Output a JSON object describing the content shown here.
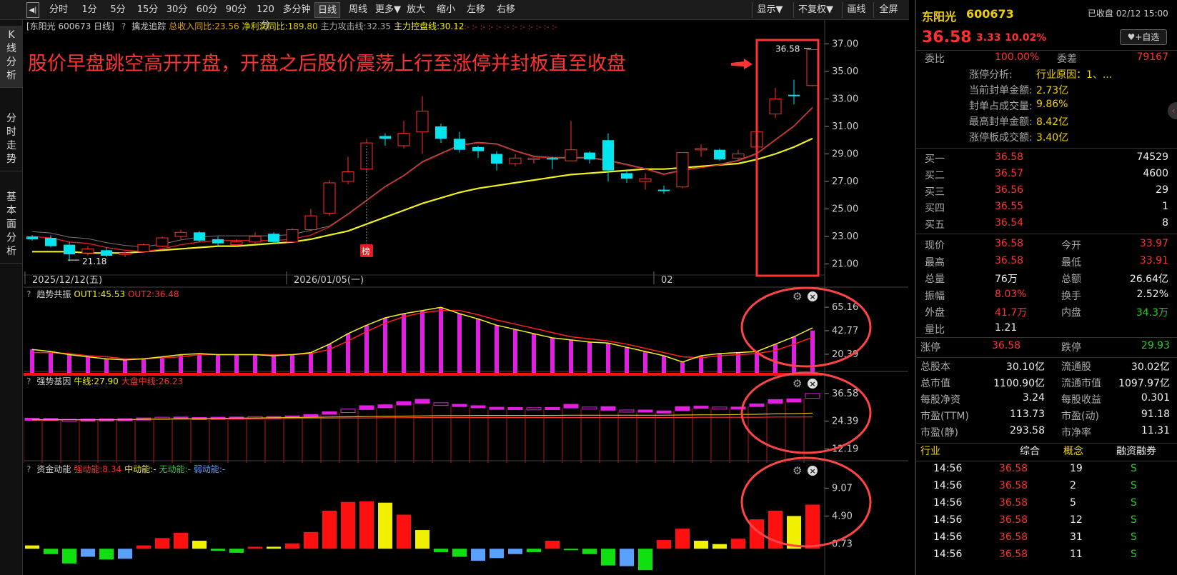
{
  "colors": {
    "up": "#ff3030",
    "down": "#00e5ee",
    "ma5": "#e02020",
    "ma10": "#f0f020",
    "bg": "#000000",
    "annotation": "#ff3333",
    "circle": "#ff4444"
  },
  "toolbar": {
    "icon": "back-arrow-icon",
    "items": [
      "分时",
      "1分",
      "5分",
      "15分",
      "30分",
      "60分",
      "90分",
      "120分",
      "多分钟",
      "日线",
      "周线",
      "更多▼",
      "放大",
      "缩小",
      "左移",
      "右移"
    ],
    "active": "日线",
    "right_items": [
      "显示▼",
      "不复权▼",
      "画线",
      "全屏"
    ]
  },
  "sidenav": {
    "items": [
      "K线分析",
      "分时走势",
      "基本面分析"
    ]
  },
  "main_chart": {
    "header": {
      "stock": "[东阳光 600673 日线]",
      "help": "?",
      "indicator": "擒龙追踪",
      "rev": "总收入同比:23.56",
      "profit": "净利润同比:189.80",
      "attack": "主力攻击线:32.35",
      "control": "主力控盘线:30.12"
    },
    "annotation": "股价早盘跳空高开开盘，开盘之后股价震荡上行至涨停并封板直至收盘",
    "price_label_high": "36.58",
    "price_label_low": "21.18",
    "badge": "榜",
    "yticks": [
      "37.00",
      "35.00",
      "33.00",
      "31.00",
      "29.00",
      "27.00",
      "25.00",
      "23.00",
      "21.00"
    ],
    "dates": [
      "2025/12/12(五)",
      "2026/01/05(一)",
      "02"
    ]
  },
  "chart_data": [
    {
      "type": "candlestick",
      "title": "东阳光 600673 日线",
      "ylim": [
        20.2,
        37.8
      ],
      "candles": [
        [
          23.0,
          22.8,
          23.1,
          22.7
        ],
        [
          22.9,
          22.3,
          23.1,
          22.2
        ],
        [
          22.4,
          21.7,
          22.6,
          21.2
        ],
        [
          21.8,
          22.1,
          22.3,
          21.6
        ],
        [
          22.0,
          21.6,
          22.2,
          21.5
        ],
        [
          21.7,
          21.8,
          21.9,
          21.5
        ],
        [
          21.9,
          22.4,
          22.5,
          21.8
        ],
        [
          22.3,
          22.9,
          23.0,
          22.2
        ],
        [
          23.0,
          23.3,
          23.5,
          22.8
        ],
        [
          23.3,
          22.7,
          23.4,
          22.6
        ],
        [
          22.8,
          22.5,
          23.0,
          22.3
        ],
        [
          22.4,
          22.6,
          22.8,
          22.3
        ],
        [
          22.6,
          23.0,
          23.3,
          22.5
        ],
        [
          23.2,
          22.6,
          23.3,
          22.5
        ],
        [
          22.6,
          23.5,
          23.6,
          22.6
        ],
        [
          23.5,
          24.5,
          25.0,
          23.4
        ],
        [
          24.7,
          26.9,
          27.1,
          24.5
        ],
        [
          27.0,
          27.7,
          28.8,
          26.8
        ],
        [
          27.9,
          29.8,
          30.1,
          27.7
        ],
        [
          30.3,
          30.1,
          30.5,
          29.6
        ],
        [
          29.6,
          30.5,
          31.4,
          29.4
        ],
        [
          30.6,
          32.1,
          33.2,
          29.0
        ],
        [
          31.0,
          30.1,
          31.2,
          29.8
        ],
        [
          30.1,
          29.3,
          30.6,
          29.1
        ],
        [
          29.5,
          29.2,
          29.6,
          28.7
        ],
        [
          29.0,
          28.3,
          29.2,
          27.8
        ],
        [
          28.3,
          28.7,
          29.0,
          28.1
        ],
        [
          28.6,
          28.7,
          28.8,
          28.3
        ],
        [
          28.7,
          28.6,
          28.8,
          27.9
        ],
        [
          28.5,
          29.3,
          31.4,
          28.5
        ],
        [
          29.1,
          28.6,
          29.2,
          28.3
        ],
        [
          30.0,
          27.8,
          30.5,
          27.0
        ],
        [
          27.6,
          27.2,
          27.8,
          26.9
        ],
        [
          27.0,
          27.2,
          27.6,
          26.4
        ],
        [
          26.4,
          26.3,
          26.7,
          26.1
        ],
        [
          26.6,
          29.1,
          29.1,
          26.5
        ],
        [
          29.3,
          29.4,
          29.7,
          28.8
        ],
        [
          29.3,
          28.6,
          29.4,
          28.5
        ],
        [
          28.7,
          29.0,
          29.3,
          28.5
        ],
        [
          29.5,
          30.6,
          31.3,
          29.5
        ],
        [
          31.9,
          33.0,
          33.8,
          31.6
        ],
        [
          33.3,
          33.2,
          34.4,
          32.6
        ],
        [
          33.97,
          36.58,
          36.58,
          33.91
        ]
      ],
      "ma5": [
        23.0,
        22.9,
        22.6,
        22.5,
        22.2,
        22.0,
        21.9,
        22.1,
        22.4,
        22.6,
        22.7,
        22.7,
        22.7,
        22.7,
        22.8,
        23.1,
        23.7,
        24.6,
        25.6,
        26.6,
        27.4,
        28.4,
        29.0,
        29.6,
        29.8,
        29.7,
        29.2,
        28.8,
        28.7,
        28.7,
        28.7,
        28.5,
        28.2,
        27.9,
        27.5,
        27.8,
        28.0,
        28.2,
        28.5,
        29.0,
        30.0,
        31.0,
        32.35
      ],
      "ma10": [
        21.9,
        21.9,
        21.9,
        21.8,
        21.8,
        21.8,
        21.9,
        22.0,
        22.1,
        22.2,
        22.3,
        22.3,
        22.4,
        22.5,
        22.6,
        22.8,
        23.1,
        23.4,
        23.9,
        24.4,
        24.9,
        25.4,
        25.8,
        26.2,
        26.5,
        26.7,
        26.9,
        27.1,
        27.3,
        27.5,
        27.6,
        27.7,
        27.8,
        27.9,
        27.9,
        28.0,
        28.1,
        28.2,
        28.3,
        28.6,
        29.0,
        29.5,
        30.12
      ]
    },
    {
      "type": "bar+line",
      "title": "趋势共振",
      "series_labels": [
        "OUT1:45.53",
        "OUT2:36.48"
      ],
      "yticks": [
        "65.16",
        "42.77",
        "20.39"
      ],
      "ylim": [
        2,
        72
      ],
      "values": [
        25,
        23,
        20,
        18,
        16,
        15,
        16,
        18,
        20,
        21,
        20,
        20,
        20,
        19,
        20,
        22,
        30,
        40,
        48,
        55,
        59,
        62,
        65,
        59,
        54,
        48,
        44,
        40,
        36,
        34,
        32,
        31,
        27,
        23,
        19,
        13,
        19,
        21,
        22,
        23,
        30,
        37,
        43
      ],
      "out1": [
        25,
        23,
        20,
        18,
        16,
        15,
        16,
        18,
        20,
        21,
        20,
        20,
        20,
        19,
        20,
        22,
        30,
        40,
        48,
        55,
        59,
        62,
        65,
        59,
        54,
        48,
        44,
        40,
        36,
        34,
        32,
        31,
        27,
        23,
        19,
        13,
        19,
        21,
        22,
        23,
        30,
        37,
        45.53
      ],
      "out2": [
        22,
        22,
        21,
        19,
        18,
        16,
        16,
        17,
        18,
        20,
        20,
        20,
        20,
        20,
        20,
        21,
        25,
        33,
        42,
        50,
        56,
        60,
        62,
        62,
        58,
        53,
        49,
        45,
        41,
        37,
        35,
        33,
        30,
        26,
        22,
        18,
        17,
        19,
        20,
        21,
        24,
        30,
        36.48
      ]
    },
    {
      "type": "box+line",
      "title": "强势基因",
      "series_labels": [
        "牛线:27.90",
        "大盘中线:26.23"
      ],
      "yticks": [
        "36.58",
        "24.39",
        "12.19"
      ],
      "ylim": [
        6,
        40
      ],
      "boxes": [
        [
          25.4,
          25.7
        ],
        [
          25.3,
          25.6
        ],
        [
          24.8,
          25.2
        ],
        [
          24.9,
          25.3
        ],
        [
          25.0,
          25.4
        ],
        [
          25.2,
          25.5
        ],
        [
          25.4,
          25.8
        ],
        [
          25.7,
          26.1
        ],
        [
          25.8,
          26.2
        ],
        [
          25.6,
          26.0
        ],
        [
          25.7,
          26.1
        ],
        [
          25.8,
          26.2
        ],
        [
          26.0,
          26.4
        ],
        [
          26.0,
          26.4
        ],
        [
          26.2,
          26.7
        ],
        [
          26.7,
          27.3
        ],
        [
          27.4,
          28.5
        ],
        [
          28.2,
          29.7
        ],
        [
          29.5,
          31.2
        ],
        [
          30.3,
          31.6
        ],
        [
          31.5,
          33.0
        ],
        [
          32.3,
          34.0
        ],
        [
          31.3,
          32.5
        ],
        [
          30.8,
          31.8
        ],
        [
          30.3,
          31.2
        ],
        [
          29.6,
          30.5
        ],
        [
          29.6,
          30.4
        ],
        [
          29.6,
          30.3
        ],
        [
          29.6,
          30.4
        ],
        [
          30.2,
          31.8
        ],
        [
          29.9,
          30.6
        ],
        [
          29.2,
          30.8
        ],
        [
          28.5,
          29.3
        ],
        [
          28.6,
          29.3
        ],
        [
          28.3,
          28.9
        ],
        [
          29.0,
          30.8
        ],
        [
          30.0,
          31.0
        ],
        [
          29.9,
          30.6
        ],
        [
          29.9,
          30.6
        ],
        [
          30.8,
          32.0
        ],
        [
          32.3,
          33.9
        ],
        [
          32.8,
          34.2
        ],
        [
          34.5,
          36.58
        ]
      ],
      "bull": [
        25.0,
        25.0,
        25.0,
        25.0,
        25.0,
        25.0,
        25.2,
        25.3,
        25.4,
        25.5,
        25.6,
        25.7,
        25.8,
        25.9,
        26.0,
        26.1,
        26.2,
        26.3,
        26.4,
        26.5,
        26.6,
        26.7,
        26.8,
        26.8,
        26.9,
        26.9,
        26.9,
        26.9,
        26.9,
        27.0,
        27.0,
        27.0,
        27.0,
        27.0,
        27.0,
        27.1,
        27.2,
        27.2,
        27.3,
        27.4,
        27.6,
        27.7,
        27.9
      ],
      "mid": [
        24.8,
        24.9,
        25.0,
        25.0,
        25.1,
        25.1,
        25.2,
        25.3,
        25.3,
        25.4,
        25.4,
        25.5,
        25.5,
        25.6,
        25.6,
        25.7,
        25.7,
        25.8,
        25.8,
        25.9,
        25.9,
        26.0,
        26.0,
        26.0,
        26.0,
        26.0,
        26.0,
        26.0,
        26.0,
        26.0,
        26.0,
        26.0,
        26.0,
        26.0,
        26.0,
        26.0,
        26.1,
        26.1,
        26.1,
        26.1,
        26.2,
        26.2,
        26.23
      ]
    },
    {
      "type": "bar",
      "title": "资金动能",
      "series_labels": [
        "强动能:8.34",
        "中动能:-",
        "无动能:-",
        "弱动能:-"
      ],
      "yticks": [
        "9.07",
        "4.90",
        "0.73"
      ],
      "ylim": [
        -3.5,
        10.5
      ],
      "values": [
        0.5,
        -0.8,
        -2.2,
        -1.2,
        -1.6,
        -1.5,
        0.5,
        1.6,
        2.4,
        1.2,
        -0.3,
        -0.6,
        0.3,
        0.3,
        0.8,
        2.5,
        5.7,
        7.0,
        7.1,
        6.9,
        5.1,
        2.8,
        -0.5,
        -1.2,
        -1.8,
        -1.4,
        -0.8,
        -0.5,
        1.2,
        -0.2,
        -0.8,
        -2.5,
        -2.6,
        -3.2,
        1.3,
        3.0,
        1.2,
        0.7,
        1.5,
        4.4,
        5.7,
        4.9,
        6.6
      ],
      "kinds": [
        "y",
        "g",
        "g",
        "b",
        "g",
        "b",
        "r",
        "r",
        "r",
        "y",
        "g",
        "g",
        "r",
        "y",
        "r",
        "r",
        "r",
        "r",
        "r",
        "y",
        "r",
        "y",
        "g",
        "g",
        "b",
        "b",
        "b",
        "g",
        "r",
        "g",
        "g",
        "g",
        "b",
        "g",
        "r",
        "r",
        "y",
        "y",
        "r",
        "r",
        "r",
        "y",
        "r"
      ]
    }
  ],
  "sub1": {
    "help": "?",
    "title": "趋势共振",
    "out1": "OUT1:45.53",
    "out2": "OUT2:36.48",
    "yticks": [
      "65.16",
      "42.77",
      "20.39"
    ]
  },
  "sub2": {
    "help": "?",
    "title": "强势基因",
    "bull": "牛线:27.90",
    "mid": "大盘中线:26.23",
    "yticks": [
      "36.58",
      "24.39",
      "12.19"
    ]
  },
  "sub3": {
    "help": "?",
    "title": "资金动能",
    "strong": "强动能:8.34",
    "med": "中动能:-",
    "none": "无动能:-",
    "weak": "弱动能:-",
    "yticks": [
      "9.07",
      "4.90",
      "0.73"
    ]
  },
  "panel": {
    "name": "东阳光",
    "code": "600673",
    "status": "已收盘 02/12 15:00",
    "price": "36.58",
    "change": "3.33",
    "pct": "10.02%",
    "watch_label": "+自选",
    "weibi_label": "委比",
    "weibi": "100.00%",
    "weicha_label": "委差",
    "weicha": "79167",
    "limit_info": [
      {
        "label": "涨停分析:",
        "value": "行业原因：1、..."
      },
      {
        "label": "当前封单金额:",
        "value": "2.73亿"
      },
      {
        "label": "封单占成交量:",
        "value": "9.86%"
      },
      {
        "label": "最高封单金额:",
        "value": "8.42亿"
      },
      {
        "label": "涨停板成交额:",
        "value": "3.40亿"
      }
    ],
    "buys": [
      {
        "label": "买一",
        "price": "36.58",
        "vol": "74529"
      },
      {
        "label": "买二",
        "price": "36.57",
        "vol": "4600"
      },
      {
        "label": "买三",
        "price": "36.56",
        "vol": "29"
      },
      {
        "label": "买四",
        "price": "36.55",
        "vol": "1"
      },
      {
        "label": "买五",
        "price": "36.54",
        "vol": "8"
      }
    ],
    "quote": [
      {
        "l1": "现价",
        "v1": "36.58",
        "c1": "red",
        "l2": "今开",
        "v2": "33.97",
        "c2": "red"
      },
      {
        "l1": "最高",
        "v1": "36.58",
        "c1": "red",
        "l2": "最低",
        "v2": "33.91",
        "c2": "red"
      },
      {
        "l1": "总量",
        "v1": "76万",
        "c1": "white",
        "l2": "总额",
        "v2": "26.64亿",
        "c2": "white"
      },
      {
        "l1": "振幅",
        "v1": "8.03%",
        "c1": "red",
        "l2": "换手",
        "v2": "2.52%",
        "c2": "white"
      },
      {
        "l1": "外盘",
        "v1": "41.7万",
        "c1": "red",
        "l2": "内盘",
        "v2": "34.3万",
        "c2": "green"
      },
      {
        "l1": "量比",
        "v1": "1.21",
        "c1": "white",
        "l2": "",
        "v2": "",
        "c2": "white"
      }
    ],
    "limits": {
      "up_label": "涨停",
      "up": "36.58",
      "down_label": "跌停",
      "down": "29.93"
    },
    "fundamentals": [
      {
        "l1": "总股本",
        "v1": "30.10亿",
        "l2": "流通股",
        "v2": "30.02亿"
      },
      {
        "l1": "总市值",
        "v1": "1100.90亿",
        "l2": "流通市值",
        "v2": "1097.97亿"
      },
      {
        "l1": "每股净资",
        "v1": "3.24",
        "l2": "每股收益",
        "v2": "0.301"
      },
      {
        "l1": "市盈(TTM)",
        "v1": "113.73",
        "l2": "市盈(动)",
        "v2": "91.18"
      },
      {
        "l1": "市盈(静)",
        "v1": "293.58",
        "l2": "市净率",
        "v2": "11.31"
      }
    ],
    "tabs": [
      "行业",
      "综合",
      "概念",
      "融资融券"
    ],
    "trades": [
      {
        "time": "14:56",
        "price": "36.58",
        "vol": "19",
        "side": "S"
      },
      {
        "time": "14:56",
        "price": "36.58",
        "vol": "2",
        "side": "S"
      },
      {
        "time": "14:56",
        "price": "36.58",
        "vol": "5",
        "side": "S"
      },
      {
        "time": "14:56",
        "price": "36.58",
        "vol": "12",
        "side": "S"
      },
      {
        "time": "14:56",
        "price": "36.58",
        "vol": "31",
        "side": "S"
      },
      {
        "time": "14:56",
        "price": "36.58",
        "vol": "11",
        "side": "S"
      }
    ]
  }
}
